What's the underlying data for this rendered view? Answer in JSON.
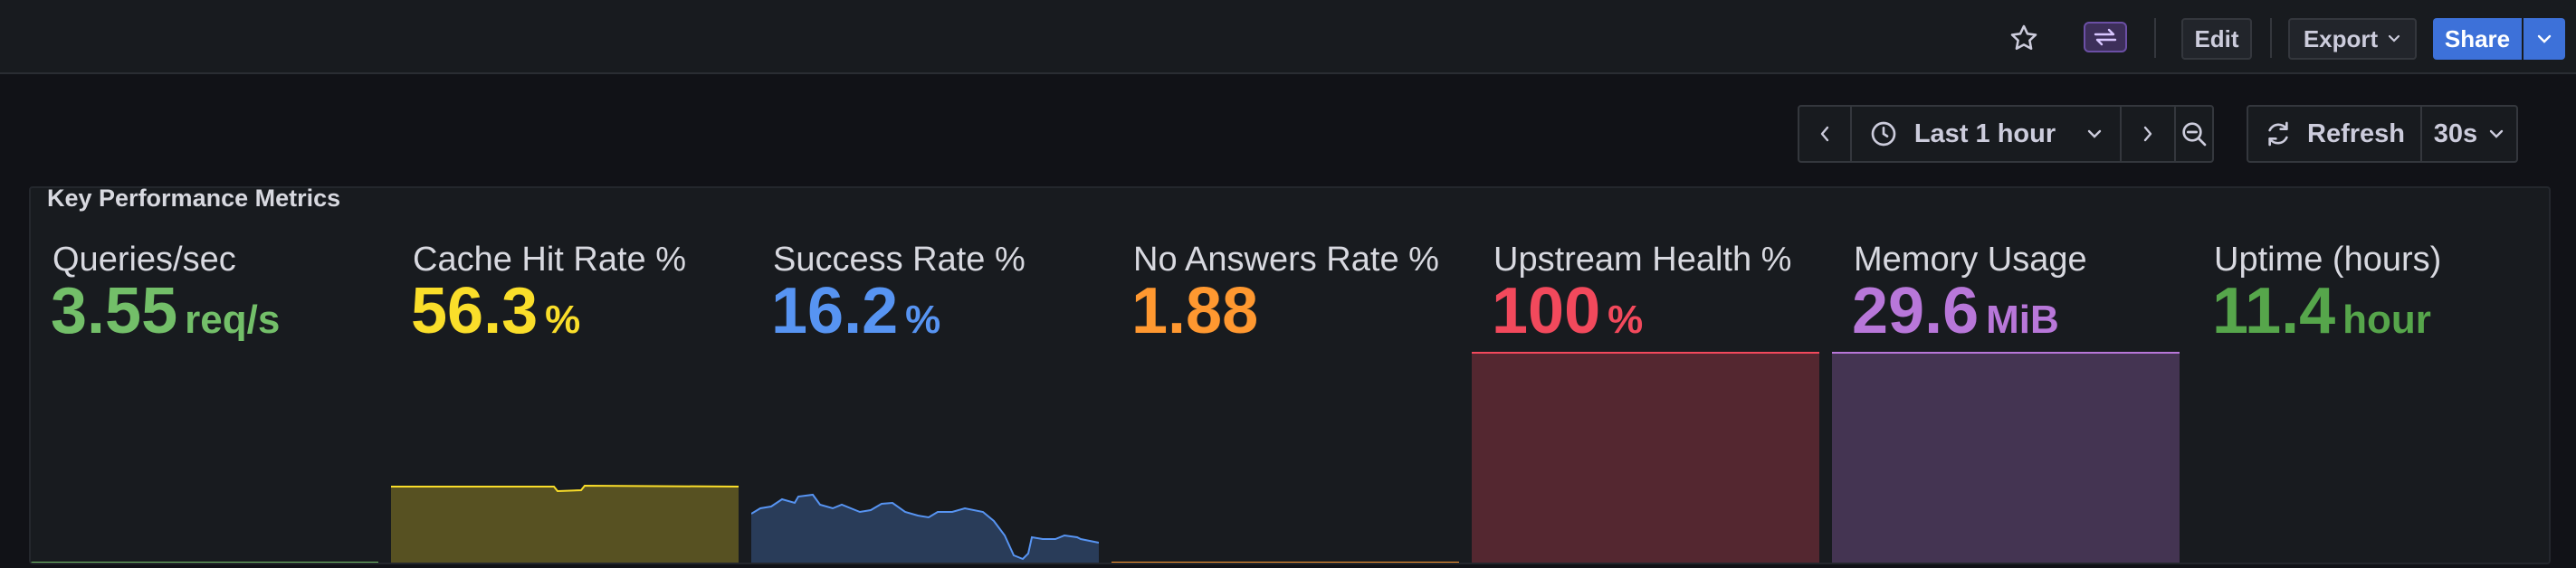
{
  "toolbar": {
    "edit_label": "Edit",
    "export_label": "Export",
    "share_label": "Share",
    "star_icon": "star-icon",
    "swap_icon": "swap-icon"
  },
  "time_controls": {
    "range_label": "Last 1 hour",
    "refresh_label": "Refresh",
    "interval_label": "30s"
  },
  "panel": {
    "title": "Key Performance Metrics",
    "stats": [
      {
        "label": "Queries/sec",
        "value": "3.55",
        "unit": "req/s",
        "color": "#73bf69",
        "spark": "flat-low"
      },
      {
        "label": "Cache Hit Rate %",
        "value": "56.3",
        "unit": "%",
        "color": "#fade2a",
        "spark": "fill-cache"
      },
      {
        "label": "Success Rate %",
        "value": "16.2",
        "unit": "%",
        "color": "#5794f2",
        "spark": "fill-success"
      },
      {
        "label": "No Answers Rate %",
        "value": "1.88",
        "unit": "",
        "color": "#ff9830",
        "spark": "flat-low"
      },
      {
        "label": "Upstream Health %",
        "value": "100",
        "unit": "%",
        "color": "#f2495c",
        "spark": "fill-full"
      },
      {
        "label": "Memory Usage",
        "value": "29.6",
        "unit": "MiB",
        "color": "#b877d9",
        "spark": "fill-full"
      },
      {
        "label": "Uptime (hours)",
        "value": "11.4",
        "unit": "hour",
        "color": "#56a64b",
        "spark": "none"
      }
    ]
  },
  "colors": {
    "share_blue": "#3d71d9",
    "panel_bg": "#181b1f",
    "page_bg": "#111217"
  }
}
